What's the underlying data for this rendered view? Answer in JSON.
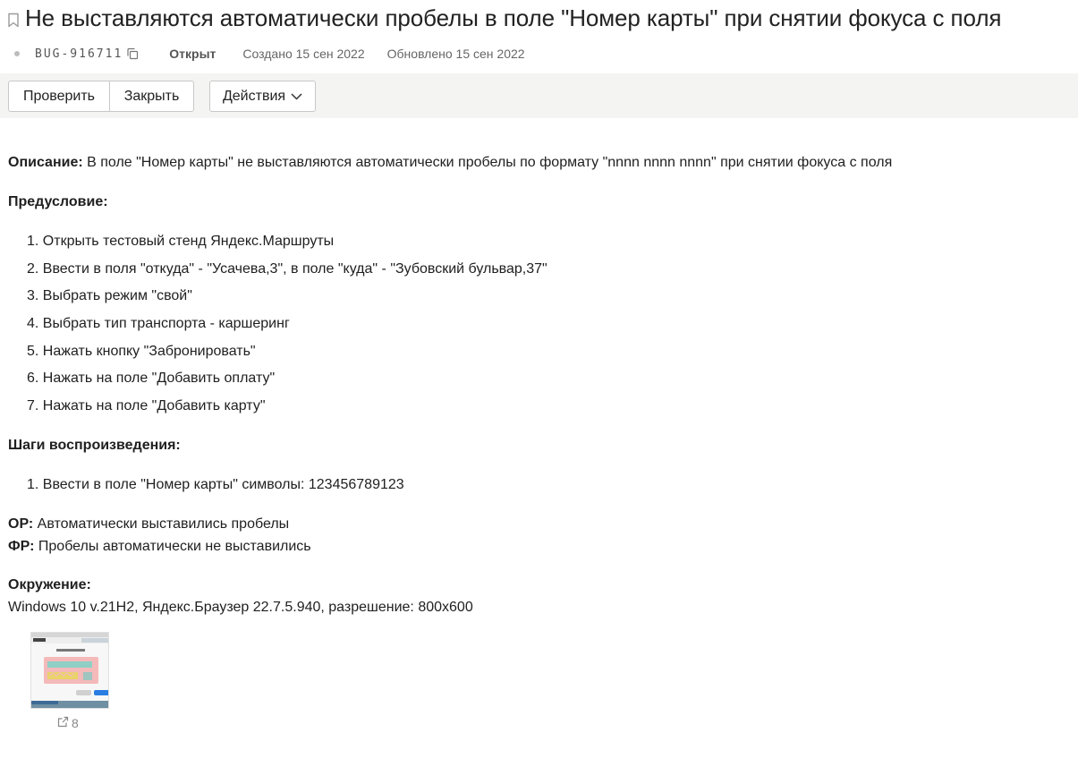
{
  "issue": {
    "title": "Не выставляются автоматически пробелы в поле \"Номер карты\" при снятии фокуса с поля",
    "id": "BUG-916711",
    "status": "Открыт",
    "created": "Создано 15 сен 2022",
    "updated": "Обновлено 15 сен 2022"
  },
  "toolbar": {
    "check_label": "Проверить",
    "close_label": "Закрыть",
    "actions_label": "Действия"
  },
  "description": {
    "label": "Описание:",
    "text": " В поле \"Номер карты\" не выставляются автоматически пробелы по формату \"nnnn nnnn nnnn\" при снятии фокуса с поля"
  },
  "precondition": {
    "label": "Предусловие:",
    "items": [
      "1. Открыть тестовый стенд Яндекс.Маршруты",
      "2. Ввести в поля \"откуда\" - \"Усачева,3\", в поле \"куда\" - \"Зубовский бульвар,37\"",
      "3. Выбрать режим \"свой\"",
      "4. Выбрать тип транспорта - каршеринг",
      "5. Нажать кнопку \"Забронировать\"",
      "6. Нажать на поле \"Добавить оплату\"",
      "7. Нажать на поле \"Добавить карту\""
    ]
  },
  "steps": {
    "label": "Шаги воспроизведения:",
    "items": [
      "1. Ввести в поле \"Номер карты\" символы: 123456789123"
    ]
  },
  "expected": {
    "label": "ОР:",
    "text": " Автоматически выставились пробелы"
  },
  "actual": {
    "label": "ФР:",
    "text": " Пробелы автоматически не выставились"
  },
  "environment": {
    "label": "Окружение:",
    "text": "Windows 10 v.21H2, Яндекс.Браузер 22.7.5.940, разрешение: 800x600"
  },
  "attachment": {
    "count": "8"
  },
  "icons": {
    "bookmark": "bookmark-icon",
    "copy": "copy-icon",
    "chevron": "chevron-down-icon",
    "external": "external-link-icon"
  }
}
